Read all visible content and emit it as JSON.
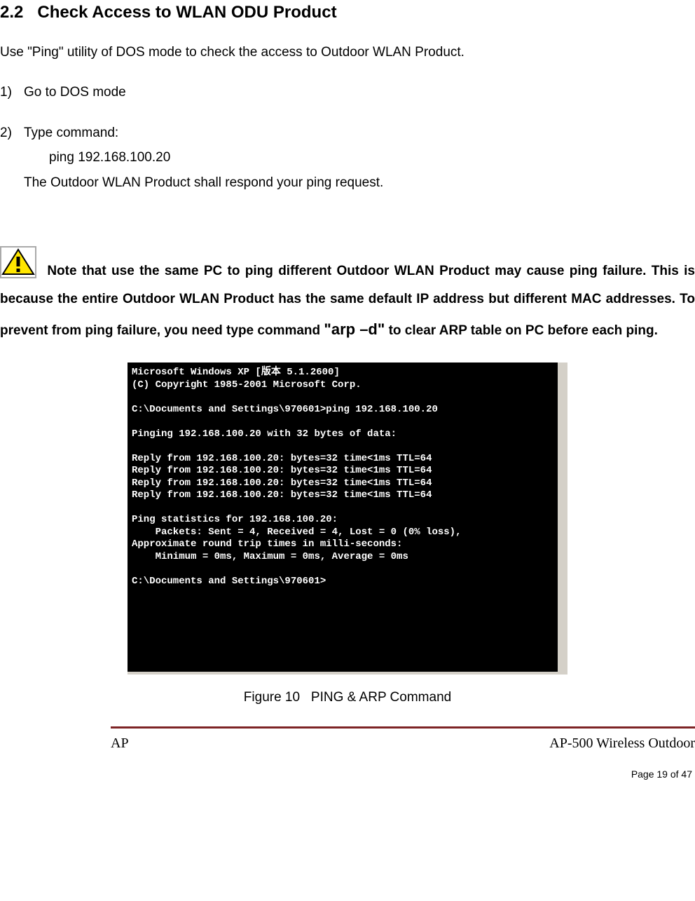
{
  "section": {
    "number": "2.2",
    "title": "Check Access to WLAN ODU Product"
  },
  "intro": "Use \"Ping\" utility of DOS mode to check the access to Outdoor WLAN Product.",
  "steps": {
    "s1_num": "1)",
    "s1_text": "Go to DOS mode",
    "s2_num": "2)",
    "s2_text": "Type command:",
    "s2_cmd": "ping 192.168.100.20",
    "s2_resp": "The Outdoor WLAN Product shall respond your ping request."
  },
  "note": {
    "pre": " Note that use the same PC to ping different Outdoor WLAN Product may cause ping failure. This is because the entire Outdoor WLAN Product has the same default IP address but different MAC addresses. To prevent from ping failure, you need type command ",
    "cmd": "\"arp –d\"",
    "post": " to clear ARP table on PC before each ping."
  },
  "console": "Microsoft Windows XP [版本 5.1.2600]\n(C) Copyright 1985-2001 Microsoft Corp.\n\nC:\\Documents and Settings\\970601>ping 192.168.100.20\n\nPinging 192.168.100.20 with 32 bytes of data:\n\nReply from 192.168.100.20: bytes=32 time<1ms TTL=64\nReply from 192.168.100.20: bytes=32 time<1ms TTL=64\nReply from 192.168.100.20: bytes=32 time<1ms TTL=64\nReply from 192.168.100.20: bytes=32 time<1ms TTL=64\n\nPing statistics for 192.168.100.20:\n    Packets: Sent = 4, Received = 4, Lost = 0 (0% loss),\nApproximate round trip times in milli-seconds:\n    Minimum = 0ms, Maximum = 0ms, Average = 0ms\n\nC:\\Documents and Settings\\970601>",
  "figure": {
    "label": "Figure 10",
    "title": "PING & ARP Command"
  },
  "footer": {
    "left": "AP",
    "right": "AP-500   Wireless  Outdoor"
  },
  "page_num": "Page 19 of 47"
}
